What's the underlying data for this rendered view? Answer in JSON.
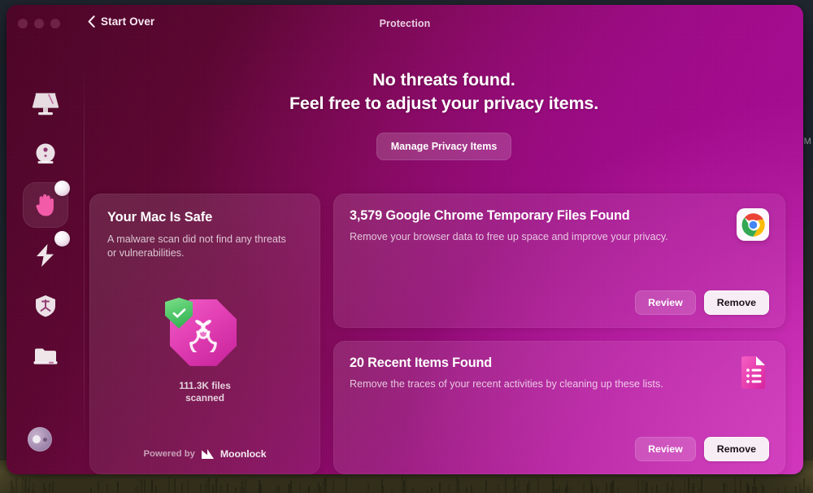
{
  "desktop": {
    "edge_label": "M"
  },
  "window": {
    "title": "Protection",
    "back_label": "Start Over",
    "back_icon": "chevron-left-icon",
    "traffic_lights": [
      "close",
      "minimize",
      "zoom"
    ]
  },
  "sidebar": {
    "items": [
      {
        "id": "dashboard",
        "icon": "mac-display-icon",
        "label": "Dashboard",
        "selected": false,
        "badge": false
      },
      {
        "id": "smart-scan",
        "icon": "smart-scan-circle-icon",
        "label": "Smart Scan",
        "selected": false,
        "badge": false
      },
      {
        "id": "protection",
        "icon": "hand-stop-icon",
        "label": "Protection",
        "selected": true,
        "badge": true
      },
      {
        "id": "performance",
        "icon": "lightning-bolt-icon",
        "label": "Performance",
        "selected": false,
        "badge": true
      },
      {
        "id": "applications",
        "icon": "shield-badge-icon",
        "label": "Applications",
        "selected": false,
        "badge": false
      },
      {
        "id": "my-clutter",
        "icon": "folder-icon",
        "label": "My Clutter",
        "selected": false,
        "badge": false
      }
    ],
    "avatar": "user-avatar"
  },
  "hero": {
    "line1": "No threats found.",
    "line2": "Feel free to adjust your privacy items.",
    "button_label": "Manage Privacy Items"
  },
  "safe_card": {
    "title": "Your Mac Is Safe",
    "description": "A malware scan did not find any threats or vulnerabilities.",
    "hazard_icon": "biohazard-icon",
    "shield_icon": "shield-check-icon",
    "scan_count_line1": "111.3K files",
    "scan_count_line2": "scanned",
    "powered_by_label": "Powered by",
    "brand_name": "Moonlock",
    "brand_icon": "moonlock-logo-icon"
  },
  "items": [
    {
      "title": "3,579 Google Chrome Temporary Files Found",
      "description": "Remove your browser data to free up space and improve your privacy.",
      "icon": "google-chrome-icon",
      "review_label": "Review",
      "remove_label": "Remove"
    },
    {
      "title": "20 Recent Items Found",
      "description": "Remove the traces of your recent activities by cleaning up these lists.",
      "icon": "recent-items-document-icon",
      "review_label": "Review",
      "remove_label": "Remove"
    }
  ],
  "colors": {
    "window_dark": "#4c0425",
    "window_bright": "#ba1da3",
    "accent_pink": "#e23fb4",
    "shield_green": "#4cc466",
    "remove_button_bg": "#f6eef4"
  }
}
